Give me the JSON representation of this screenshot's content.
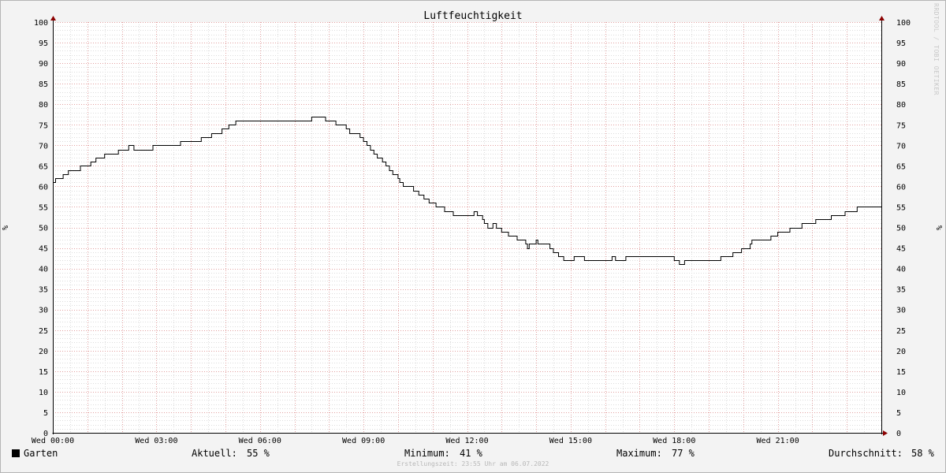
{
  "chart_data": {
    "type": "line",
    "title": "Luftfeuchtigkeit",
    "ylabel_left": "%",
    "ylabel_right": "%",
    "ylim": [
      0,
      100
    ],
    "y_ticks": [
      0,
      5,
      10,
      15,
      20,
      25,
      30,
      35,
      40,
      45,
      50,
      55,
      60,
      65,
      70,
      75,
      80,
      85,
      90,
      95,
      100
    ],
    "x_range_hours": [
      0,
      24
    ],
    "x_ticks": [
      {
        "hour": 0,
        "label": "Wed 00:00"
      },
      {
        "hour": 3,
        "label": "Wed 03:00"
      },
      {
        "hour": 6,
        "label": "Wed 06:00"
      },
      {
        "hour": 9,
        "label": "Wed 09:00"
      },
      {
        "hour": 12,
        "label": "Wed 12:00"
      },
      {
        "hour": 15,
        "label": "Wed 15:00"
      },
      {
        "hour": 18,
        "label": "Wed 18:00"
      },
      {
        "hour": 21,
        "label": "Wed 21:00"
      }
    ],
    "grid": true,
    "series": [
      {
        "name": "Garten",
        "color": "#000000",
        "points": [
          [
            0.0,
            61
          ],
          [
            0.08,
            62
          ],
          [
            0.3,
            63
          ],
          [
            0.45,
            64
          ],
          [
            0.8,
            65
          ],
          [
            1.1,
            66
          ],
          [
            1.25,
            67
          ],
          [
            1.5,
            68
          ],
          [
            1.9,
            69
          ],
          [
            2.2,
            70
          ],
          [
            2.35,
            69
          ],
          [
            2.9,
            70
          ],
          [
            3.7,
            71
          ],
          [
            4.3,
            72
          ],
          [
            4.6,
            73
          ],
          [
            4.9,
            74
          ],
          [
            5.1,
            75
          ],
          [
            5.3,
            76
          ],
          [
            7.5,
            77
          ],
          [
            7.9,
            76
          ],
          [
            8.2,
            75
          ],
          [
            8.5,
            74
          ],
          [
            8.6,
            73
          ],
          [
            8.9,
            72
          ],
          [
            9.0,
            71
          ],
          [
            9.1,
            70
          ],
          [
            9.2,
            69
          ],
          [
            9.3,
            68
          ],
          [
            9.4,
            67
          ],
          [
            9.55,
            66
          ],
          [
            9.65,
            65
          ],
          [
            9.75,
            64
          ],
          [
            9.85,
            63
          ],
          [
            10.0,
            62
          ],
          [
            10.05,
            61
          ],
          [
            10.15,
            60
          ],
          [
            10.45,
            59
          ],
          [
            10.6,
            58
          ],
          [
            10.75,
            57
          ],
          [
            10.9,
            56
          ],
          [
            11.1,
            55
          ],
          [
            11.35,
            54
          ],
          [
            11.6,
            53
          ],
          [
            12.2,
            54
          ],
          [
            12.3,
            53
          ],
          [
            12.45,
            52
          ],
          [
            12.5,
            51
          ],
          [
            12.6,
            50
          ],
          [
            12.75,
            51
          ],
          [
            12.85,
            50
          ],
          [
            13.0,
            49
          ],
          [
            13.2,
            48
          ],
          [
            13.45,
            47
          ],
          [
            13.7,
            46
          ],
          [
            13.75,
            45
          ],
          [
            13.8,
            46
          ],
          [
            14.0,
            47
          ],
          [
            14.05,
            46
          ],
          [
            14.4,
            45
          ],
          [
            14.5,
            44
          ],
          [
            14.65,
            43
          ],
          [
            14.8,
            42
          ],
          [
            15.1,
            43
          ],
          [
            15.4,
            42
          ],
          [
            16.2,
            43
          ],
          [
            16.3,
            42
          ],
          [
            16.6,
            43
          ],
          [
            18.0,
            42
          ],
          [
            18.15,
            41
          ],
          [
            18.3,
            42
          ],
          [
            19.35,
            43
          ],
          [
            19.7,
            44
          ],
          [
            19.95,
            45
          ],
          [
            20.2,
            46
          ],
          [
            20.25,
            47
          ],
          [
            20.8,
            48
          ],
          [
            21.0,
            49
          ],
          [
            21.35,
            50
          ],
          [
            21.7,
            51
          ],
          [
            22.1,
            52
          ],
          [
            22.55,
            53
          ],
          [
            22.95,
            54
          ],
          [
            23.3,
            55
          ],
          [
            24.0,
            55
          ]
        ]
      }
    ]
  },
  "legend": {
    "series_name": "Garten",
    "current_label": "Aktuell:",
    "current_value": "55 %",
    "min_label": "Minimum:",
    "min_value": "41 %",
    "max_label": "Maximum:",
    "max_value": "77 %",
    "avg_label": "Durchschnitt:",
    "avg_value": "58 %"
  },
  "footer": {
    "created": "Erstellungszeit: 23:55 Uhr am 06.07.2022",
    "watermark": "RRDTOOL / TOBI OETIKER"
  },
  "colors": {
    "background": "#f3f3f3",
    "plot_background": "#ffffff",
    "grid_minor": "#dcdcdc",
    "grid_major": "#e2a0a0",
    "axis": "#000000",
    "arrow": "#8b0000",
    "line": "#000000"
  }
}
